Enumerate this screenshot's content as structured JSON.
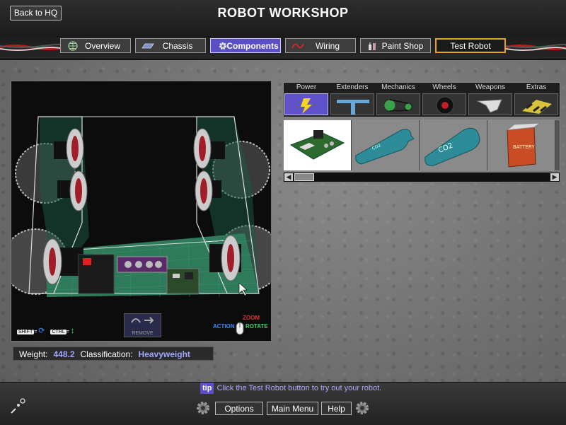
{
  "header": {
    "title": "ROBOT WORKSHOP",
    "back_label": "Back to HQ"
  },
  "tabs": [
    {
      "label": "Overview",
      "icon": "globe-icon",
      "active": false
    },
    {
      "label": "Chassis",
      "icon": "chassis-icon",
      "active": false
    },
    {
      "label": "Components",
      "icon": "gear-icon",
      "active": true
    },
    {
      "label": "Wiring",
      "icon": "wire-icon",
      "active": false
    },
    {
      "label": "Paint Shop",
      "icon": "paint-icon",
      "active": false
    }
  ],
  "test_robot_label": "Test Robot",
  "viewport": {
    "hint_shift": "SHIFT",
    "hint_ctrl": "CTRL",
    "hint_equals": "=",
    "remove_label": "REMOVE",
    "zoom_label": "ZOOM",
    "action_label": "ACTION",
    "rotate_label": "ROTATE"
  },
  "stats": {
    "weight_label": "Weight:",
    "weight_value": "448.2",
    "class_label": "Classification:",
    "class_value": "Heavyweight"
  },
  "categories": [
    {
      "label": "Power",
      "icon": "lightning-icon",
      "active": true
    },
    {
      "label": "Extenders",
      "icon": "extender-icon",
      "active": false
    },
    {
      "label": "Mechanics",
      "icon": "chain-icon",
      "active": false
    },
    {
      "label": "Wheels",
      "icon": "wheel-icon",
      "active": false
    },
    {
      "label": "Weapons",
      "icon": "blade-icon",
      "active": false
    },
    {
      "label": "Extras",
      "icon": "hazard-icon",
      "active": false
    }
  ],
  "parts": [
    {
      "name": "speed-controller",
      "selected": true
    },
    {
      "name": "gas-tank",
      "selected": false,
      "text": "CO2"
    },
    {
      "name": "co2-tank",
      "selected": false,
      "text": "CO2"
    },
    {
      "name": "battery",
      "selected": false,
      "text": "BATTERY"
    }
  ],
  "footer": {
    "tip_badge": "tip",
    "tip_text": "Click the Test Robot button to try out your robot.",
    "options_label": "Options",
    "main_menu_label": "Main Menu",
    "help_label": "Help"
  },
  "colors": {
    "accent": "#5b4fc6",
    "test_border": "#e8a21c",
    "value_text": "#9fa6ff",
    "board_green": "#2f7a5a"
  }
}
